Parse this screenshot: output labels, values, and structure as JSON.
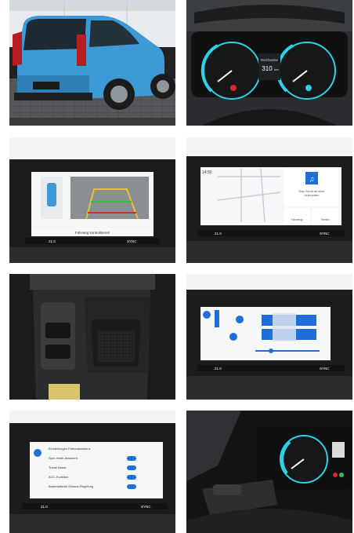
{
  "cluster": {
    "range_label": "Reichweite",
    "range_value": "310",
    "range_unit": "km"
  },
  "parking_screen": {
    "caption": "Fahrweg kontrollieren!",
    "temp": "21.0",
    "sync": "SYNC"
  },
  "home_screen": {
    "time": "14:50",
    "media_line1": "Das Gerät ist nicht",
    "media_line2": "verbunden",
    "tile_vehicle": "Fahrzeug",
    "tile_phone": "Telefon",
    "temp": "21.0",
    "sync": "SYNC"
  },
  "climate_screen": {
    "temp": "21.0",
    "sync": "SYNC"
  },
  "assist_screen": {
    "header": "Einstellungen Fahrerassistenz",
    "items": [
      "Spur-Halte-Assistent",
      "Travel Assist",
      "ACC-Funktion",
      "Automatische Distanz-Regelung"
    ],
    "temp": "21.0",
    "sync": "SYNC"
  },
  "colors": {
    "car_blue": "#3d9ad6",
    "screen_blue": "#1e6fd9",
    "gauge_teal": "#2fd0e6",
    "warning_red": "#d8262e"
  }
}
